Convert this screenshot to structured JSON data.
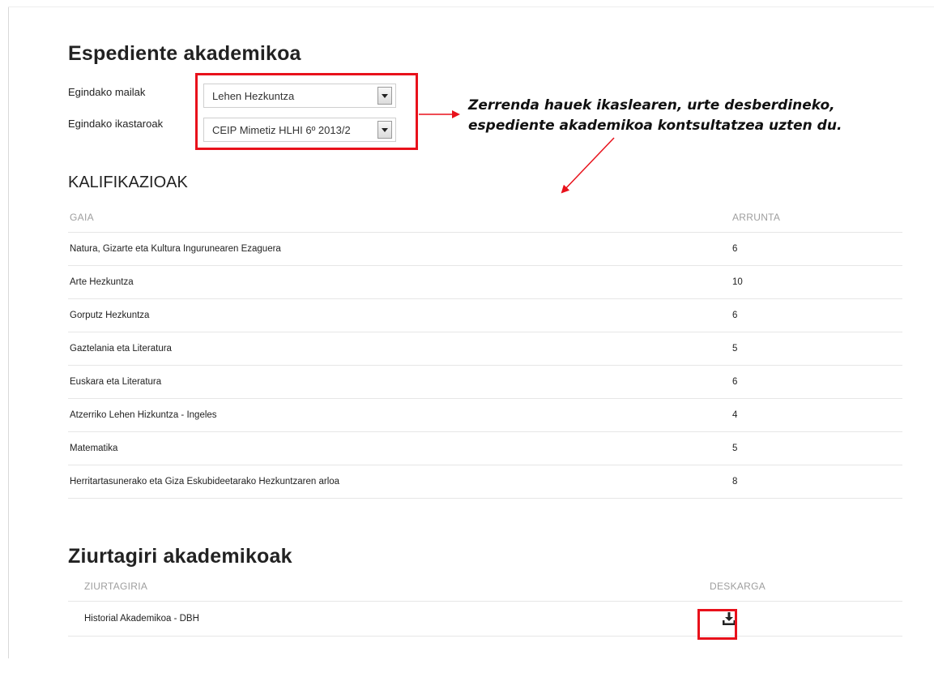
{
  "record": {
    "title": "Espediente akademikoa",
    "levels_label": "Egindako mailak",
    "levels_value": "Lehen Hezkuntza",
    "courses_label": "Egindako ikastaroak",
    "courses_value": "CEIP Mimetiz HLHI 6º 2013/2"
  },
  "annotation": {
    "line1": "Zerrenda hauek ikaslearen, urte desberdineko,",
    "line2": "espediente akademikoa kontsultatzea uzten du."
  },
  "grades": {
    "title": "KALIFIKAZIOAK",
    "headers": {
      "subject": "GAIA",
      "grade": "ARRUNTA"
    },
    "rows": [
      {
        "subject": "Natura, Gizarte eta Kultura Ingurunearen Ezaguera",
        "grade": "6"
      },
      {
        "subject": "Arte Hezkuntza",
        "grade": "10"
      },
      {
        "subject": "Gorputz Hezkuntza",
        "grade": "6"
      },
      {
        "subject": "Gaztelania eta Literatura",
        "grade": "5"
      },
      {
        "subject": "Euskara eta Literatura",
        "grade": "6"
      },
      {
        "subject": "Atzerriko Lehen Hizkuntza - Ingeles",
        "grade": "4"
      },
      {
        "subject": "Matematika",
        "grade": "5"
      },
      {
        "subject": "Herritartasunerako eta Giza Eskubideetarako Hezkuntzaren arloa",
        "grade": "8"
      }
    ]
  },
  "certificates": {
    "title": "Ziurtagiri akademikoak",
    "headers": {
      "certificate": "ZIURTAGIRIA",
      "download": "DESKARGA"
    },
    "rows": [
      {
        "name": "Historial Akademikoa - DBH",
        "download_icon": "download-icon"
      }
    ]
  },
  "colors": {
    "highlight": "#e8111b",
    "header_text": "#9e9e9e",
    "row_border": "#e6e6e6"
  }
}
